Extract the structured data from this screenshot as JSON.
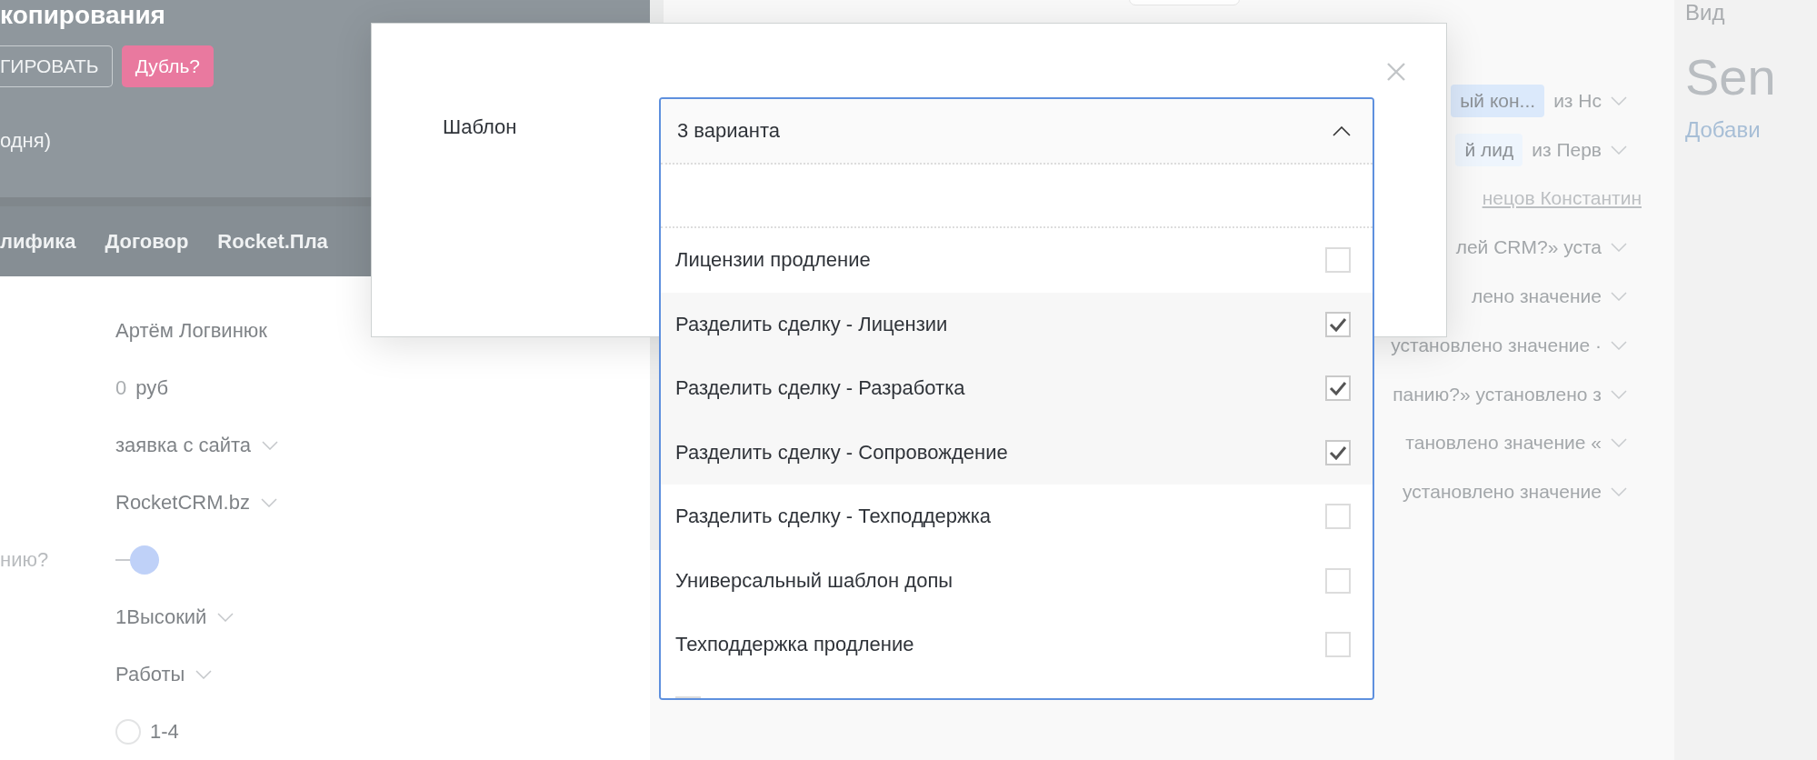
{
  "deal_header": {
    "title": "копирования",
    "buttons": [
      {
        "label": "ГИРОВАТЬ",
        "kind": "outline"
      },
      {
        "label": "Дубль?",
        "kind": "pink"
      }
    ],
    "subtitle": "одня)"
  },
  "tabs": [
    {
      "label": "лифика"
    },
    {
      "label": "Договор"
    },
    {
      "label": "Rocket.Пла"
    }
  ],
  "fields": [
    {
      "kind": "text",
      "value": "Артём Логвинюк"
    },
    {
      "kind": "money",
      "amount": "0",
      "unit": "руб"
    },
    {
      "kind": "select",
      "value": "заявка с сайта"
    },
    {
      "kind": "select",
      "value": "RocketCRM.bz"
    },
    {
      "kind": "toggle",
      "label": "нию?",
      "on": true
    },
    {
      "kind": "select",
      "value": "1Высокий"
    },
    {
      "kind": "select",
      "value": "Работы"
    },
    {
      "kind": "radio",
      "value": "1-4",
      "selected": false
    }
  ],
  "activity": [
    {
      "kind": "tag",
      "tag": "ый кон...",
      "color": "#dbe9fb",
      "text": "из Нс"
    },
    {
      "kind": "tag",
      "tag": "й лид",
      "color": "#eef5fd",
      "text": "из Перв"
    },
    {
      "kind": "link",
      "text": "нецов Константин"
    },
    {
      "kind": "change",
      "text": "лей CRM?» уста"
    },
    {
      "kind": "change",
      "text": "лено значение"
    },
    {
      "kind": "change",
      "text": "установлено значение ·"
    },
    {
      "kind": "change",
      "text": "панию?» установлено з"
    },
    {
      "kind": "change",
      "text": "тановлено значение «"
    },
    {
      "kind": "change",
      "text": "установлено значение"
    }
  ],
  "right_panel": {
    "heading": "Вид",
    "title": "Sen",
    "link": "Добави"
  },
  "modal": {
    "label": "Шаблон",
    "select": {
      "value": "3 варианта",
      "expanded": true,
      "options": [
        {
          "label": "Лицензии продление",
          "checked": false
        },
        {
          "label": "Разделить сделку - Лицензии",
          "checked": true
        },
        {
          "label": "Разделить сделку - Разработка",
          "checked": true
        },
        {
          "label": "Разделить сделку - Сопровождение",
          "checked": true
        },
        {
          "label": "Разделить сделку - Техподдержка",
          "checked": false
        },
        {
          "label": "Универсальный шаблон допы",
          "checked": false
        },
        {
          "label": "Техподдержка продление",
          "checked": false
        }
      ]
    }
  }
}
